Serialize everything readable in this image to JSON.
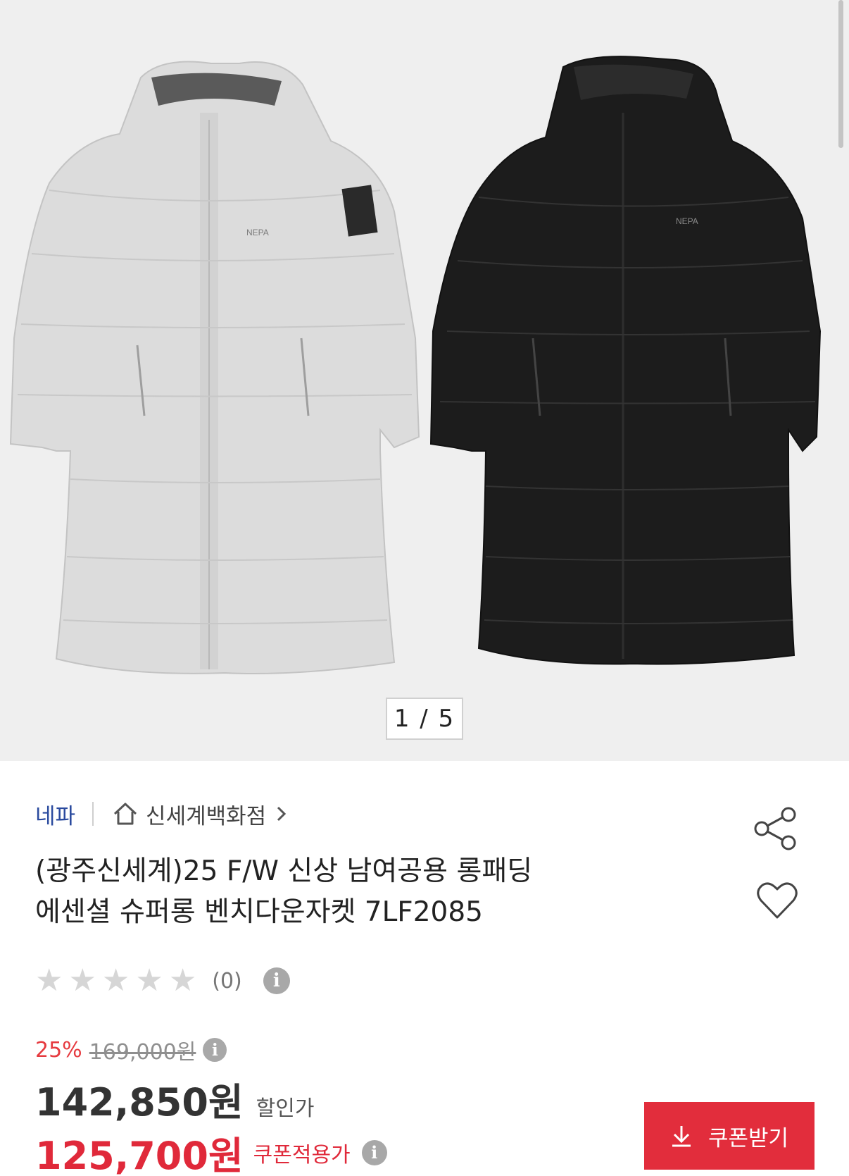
{
  "gallery": {
    "counter": "1 / 5",
    "images": [
      "light-gray-long-padded-jacket",
      "black-long-padded-jacket"
    ]
  },
  "product": {
    "brand": "네파",
    "store": "신세계백화점",
    "title_line1": "(광주신세계)25 F/W 신상 남여공용 롱패딩",
    "title_line2": "에센셜 슈퍼롱 벤치다운자켓 7LF2085",
    "review_count": "(0)",
    "rating_stars": 0
  },
  "price": {
    "discount_pct": "25%",
    "original": "169,000원",
    "sale": "142,850원",
    "sale_label": "할인가",
    "coupon": "125,700원",
    "coupon_label": "쿠폰적용가"
  },
  "actions": {
    "coupon_button": "쿠폰받기"
  },
  "icons": {
    "info": "i"
  },
  "colors": {
    "brand_link": "#2a4a9e",
    "accent_red": "#e22d3c"
  }
}
